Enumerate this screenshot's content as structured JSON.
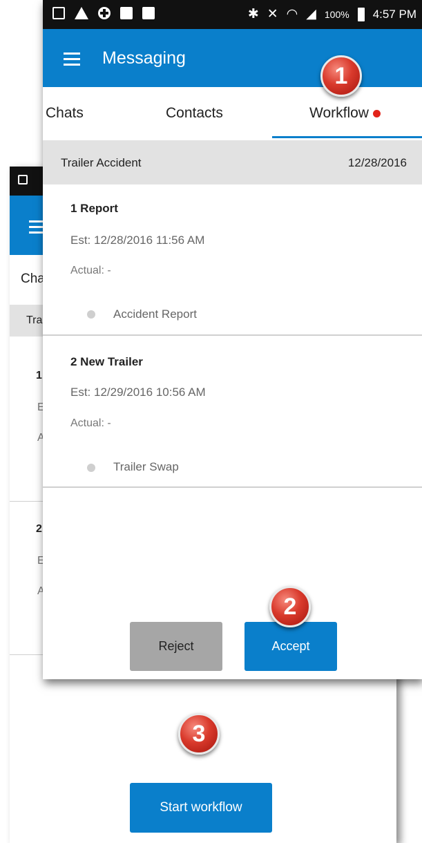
{
  "status_bar": {
    "battery_pct": "100%",
    "time": "4:57 PM"
  },
  "app": {
    "title": "Messaging"
  },
  "tabs": [
    {
      "label": "Chats"
    },
    {
      "label": "Contacts"
    },
    {
      "label": "Workflow",
      "active": true,
      "has_notification": true
    }
  ],
  "workflow": {
    "name": "Trailer Accident",
    "date": "12/28/2016",
    "steps": [
      {
        "title": "1 Report",
        "est": "Est: 12/28/2016 11:56 AM",
        "actual": "Actual: -",
        "task": "Accident Report"
      },
      {
        "title": "2 New Trailer",
        "est": "Est: 12/29/2016 10:56 AM",
        "actual": "Actual: -",
        "task": "Trailer Swap"
      }
    ]
  },
  "actions": {
    "reject_label": "Reject",
    "accept_label": "Accept",
    "start_label": "Start workflow"
  },
  "back_screen": {
    "tab_partial": "Cha",
    "header_partial": "Tra",
    "row1_num": "1",
    "row1_est": "E",
    "row1_actual": "A",
    "row2_num": "2",
    "row2_est": "E",
    "row2_actual": "A"
  },
  "callouts": [
    "1",
    "2",
    "3"
  ],
  "colors": {
    "primary": "#0a7fcb",
    "status_bar": "#111111",
    "header_gray": "#e2e2e2",
    "reject_gray": "#a6a6a6",
    "notification_dot": "#e2231a",
    "callout_red": "#d93a2c"
  }
}
